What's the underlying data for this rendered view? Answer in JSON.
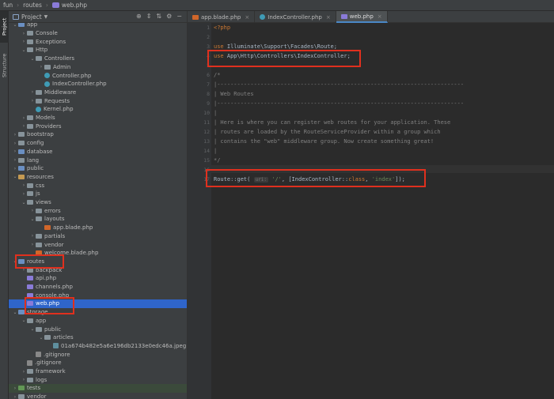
{
  "breadcrumb": [
    "fun",
    "routes",
    "web.php"
  ],
  "sidebar_tabs": {
    "project": "Project",
    "structure": "Structure"
  },
  "project_panel": {
    "title": "Project",
    "tool_icons": [
      "target-icon",
      "collapse-icon",
      "expand-icon",
      "gear-icon",
      "minimize-icon"
    ]
  },
  "tree": [
    {
      "label": "app",
      "depth": 1,
      "arrow": "v",
      "icon": "folder",
      "partial": true
    },
    {
      "label": "Console",
      "depth": 2,
      "arrow": ">",
      "icon": "folder"
    },
    {
      "label": "Exceptions",
      "depth": 2,
      "arrow": ">",
      "icon": "folder"
    },
    {
      "label": "Http",
      "depth": 2,
      "arrow": "v",
      "icon": "folder"
    },
    {
      "label": "Controllers",
      "depth": 3,
      "arrow": "v",
      "icon": "folder"
    },
    {
      "label": "Admin",
      "depth": 4,
      "arrow": ">",
      "icon": "folder"
    },
    {
      "label": "Controller.php",
      "depth": 4,
      "arrow": "",
      "icon": "class"
    },
    {
      "label": "IndexController.php",
      "depth": 4,
      "arrow": "",
      "icon": "class"
    },
    {
      "label": "Middleware",
      "depth": 3,
      "arrow": ">",
      "icon": "folder"
    },
    {
      "label": "Requests",
      "depth": 3,
      "arrow": ">",
      "icon": "folder"
    },
    {
      "label": "Kernel.php",
      "depth": 3,
      "arrow": "",
      "icon": "class"
    },
    {
      "label": "Models",
      "depth": 2,
      "arrow": ">",
      "icon": "folder"
    },
    {
      "label": "Providers",
      "depth": 2,
      "arrow": ">",
      "icon": "folder"
    },
    {
      "label": "bootstrap",
      "depth": 1,
      "arrow": ">",
      "icon": "folder"
    },
    {
      "label": "config",
      "depth": 1,
      "arrow": ">",
      "icon": "folder"
    },
    {
      "label": "database",
      "depth": 1,
      "arrow": ">",
      "icon": "folder"
    },
    {
      "label": "lang",
      "depth": 1,
      "arrow": ">",
      "icon": "folder"
    },
    {
      "label": "public",
      "depth": 1,
      "arrow": ">",
      "icon": "folder"
    },
    {
      "label": "resources",
      "depth": 1,
      "arrow": "v",
      "icon": "folder"
    },
    {
      "label": "css",
      "depth": 2,
      "arrow": ">",
      "icon": "folder"
    },
    {
      "label": "js",
      "depth": 2,
      "arrow": ">",
      "icon": "folder"
    },
    {
      "label": "views",
      "depth": 2,
      "arrow": "v",
      "icon": "folder"
    },
    {
      "label": "errors",
      "depth": 3,
      "arrow": ">",
      "icon": "folder"
    },
    {
      "label": "layouts",
      "depth": 3,
      "arrow": "v",
      "icon": "folder"
    },
    {
      "label": "app.blade.php",
      "depth": 4,
      "arrow": "",
      "icon": "blade"
    },
    {
      "label": "partials",
      "depth": 3,
      "arrow": ">",
      "icon": "folder"
    },
    {
      "label": "vendor",
      "depth": 3,
      "arrow": ">",
      "icon": "folder"
    },
    {
      "label": "welcome.blade.php",
      "depth": 3,
      "arrow": "",
      "icon": "blade"
    },
    {
      "label": "routes",
      "depth": 1,
      "arrow": "v",
      "icon": "folder"
    },
    {
      "label": "backpack",
      "depth": 2,
      "arrow": ">",
      "icon": "folder"
    },
    {
      "label": "api.php",
      "depth": 2,
      "arrow": "",
      "icon": "php"
    },
    {
      "label": "channels.php",
      "depth": 2,
      "arrow": "",
      "icon": "php"
    },
    {
      "label": "console.php",
      "depth": 2,
      "arrow": "",
      "icon": "php"
    },
    {
      "label": "web.php",
      "depth": 2,
      "arrow": "",
      "icon": "php",
      "selected": true
    },
    {
      "label": "storage",
      "depth": 1,
      "arrow": "v",
      "icon": "folder"
    },
    {
      "label": "app",
      "depth": 2,
      "arrow": "v",
      "icon": "folder"
    },
    {
      "label": "public",
      "depth": 3,
      "arrow": "v",
      "icon": "folder"
    },
    {
      "label": "articles",
      "depth": 4,
      "arrow": "v",
      "icon": "folder"
    },
    {
      "label": "01a674b482e5a6e196db2133e0edc46a.jpeg",
      "depth": 5,
      "arrow": "",
      "icon": "jpg"
    },
    {
      "label": ".gitignore",
      "depth": 3,
      "arrow": "",
      "icon": "git"
    },
    {
      "label": ".gitignore",
      "depth": 2,
      "arrow": "",
      "icon": "git"
    },
    {
      "label": "framework",
      "depth": 2,
      "arrow": ">",
      "icon": "folder"
    },
    {
      "label": "logs",
      "depth": 2,
      "arrow": ">",
      "icon": "folder"
    },
    {
      "label": "tests",
      "depth": 1,
      "arrow": ">",
      "icon": "folder-green",
      "highlight": true
    },
    {
      "label": "vendor",
      "depth": 1,
      "arrow": ">",
      "icon": "folder",
      "partial": true
    }
  ],
  "tabs": [
    {
      "label": "app.blade.php",
      "icon": "blade"
    },
    {
      "label": "IndexController.php",
      "icon": "class"
    },
    {
      "label": "web.php",
      "icon": "php",
      "active": true
    }
  ],
  "code": {
    "line_numbers": [
      "1",
      "2",
      "3",
      "4",
      "5",
      "6",
      "7",
      "8",
      "9",
      "10",
      "11",
      "12",
      "13",
      "14",
      "15",
      "16",
      "17"
    ],
    "lines": [
      "<?php",
      "",
      "use Illuminate\\Support\\Facades\\Route;",
      "use App\\Http\\Controllers\\IndexController;",
      "",
      "/*",
      "|--------------------------------------------------------------------------",
      "| Web Routes",
      "|--------------------------------------------------------------------------",
      "|",
      "| Here is where you can register web routes for your application. These",
      "| routes are loaded by the RouteServiceProvider within a group which",
      "| contains the \"web\" middleware group. Now create something great!",
      "|",
      "*/",
      "",
      "Route::get( uri: '/', [IndexController::class, 'index']);"
    ],
    "route_parts": {
      "prefix": "Route::get(",
      "hint": "uri:",
      "path": "'/'",
      "mid": ", [IndexController::",
      "kw": "class",
      "comma": ", ",
      "action": "'index'",
      "end": "]);"
    },
    "use_kw": "use",
    "use1": "Illuminate\\Support\\Facades\\Route;",
    "use2": "App\\Http\\Controllers\\IndexController;"
  },
  "colors": {
    "highlight_box": "#e0301e",
    "selection": "#2f65ca",
    "keyword": "#cc7832",
    "string": "#6a8759",
    "comment": "#808080"
  }
}
